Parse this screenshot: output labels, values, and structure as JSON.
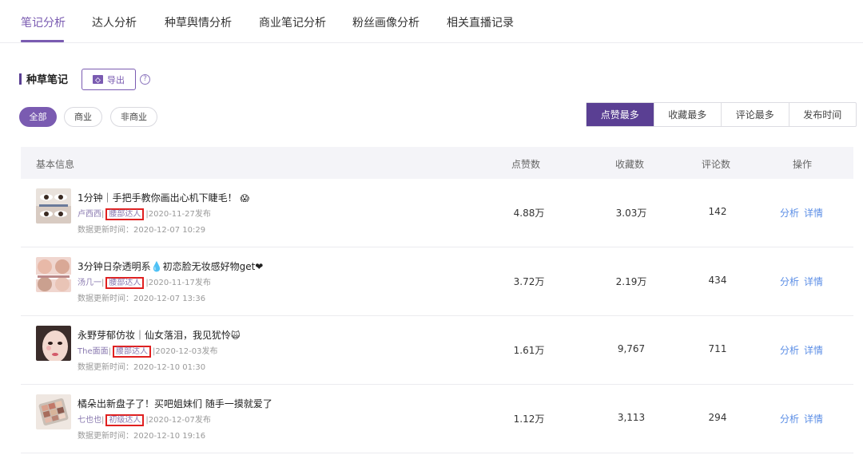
{
  "tabs": [
    "笔记分析",
    "达人分析",
    "种草舆情分析",
    "商业笔记分析",
    "粉丝画像分析",
    "相关直播记录"
  ],
  "section": {
    "title": "种草笔记",
    "export_label": "导出",
    "help": "?"
  },
  "filters": [
    "全部",
    "商业",
    "非商业"
  ],
  "sort": [
    "点赞最多",
    "收藏最多",
    "评论最多",
    "发布时间"
  ],
  "table": {
    "headers": {
      "info": "基本信息",
      "likes": "点赞数",
      "favorites": "收藏数",
      "comments": "评论数",
      "ops": "操作"
    },
    "rows": [
      {
        "title": "1分钟｜手把手教你画出心机下睫毛！",
        "emoji": "😱",
        "author": "卢西西",
        "tag": "腰部达人",
        "date": "2020-11-27发布",
        "update": "数据更新时间：2020-12-07 10:29",
        "likes": "4.88万",
        "favorites": "3.03万",
        "comments": "142"
      },
      {
        "title": "3分钟日杂透明系💧初恋脸无妆感好物get❤",
        "emoji": "",
        "author": "汤几一",
        "tag": "腰部达人",
        "date": "2020-11-17发布",
        "update": "数据更新时间：2020-12-07 13:36",
        "likes": "3.72万",
        "favorites": "2.19万",
        "comments": "434"
      },
      {
        "title": "永野芽郁仿妆｜仙女落泪，我见犹怜",
        "emoji": "🙀",
        "author": "The面面",
        "tag": "腰部达人",
        "date": "2020-12-03发布",
        "update": "数据更新时间：2020-12-10 01:30",
        "likes": "1.61万",
        "favorites": "9,767",
        "comments": "711"
      },
      {
        "title": "橘朵出新盘子了！买吧姐妹们 随手一摸就爱了",
        "emoji": "",
        "author": "七也也",
        "tag": "初级达人",
        "date": "2020-12-07发布",
        "update": "数据更新时间：2020-12-10 19:16",
        "likes": "1.12万",
        "favorites": "3,113",
        "comments": "294"
      }
    ],
    "op_analyze": "分析",
    "op_detail": "详情"
  },
  "colors": {
    "accent": "#7a5bb1",
    "accent_dark": "#5a3f93",
    "link": "#5b8ee6",
    "highlight_box": "#e02020"
  }
}
